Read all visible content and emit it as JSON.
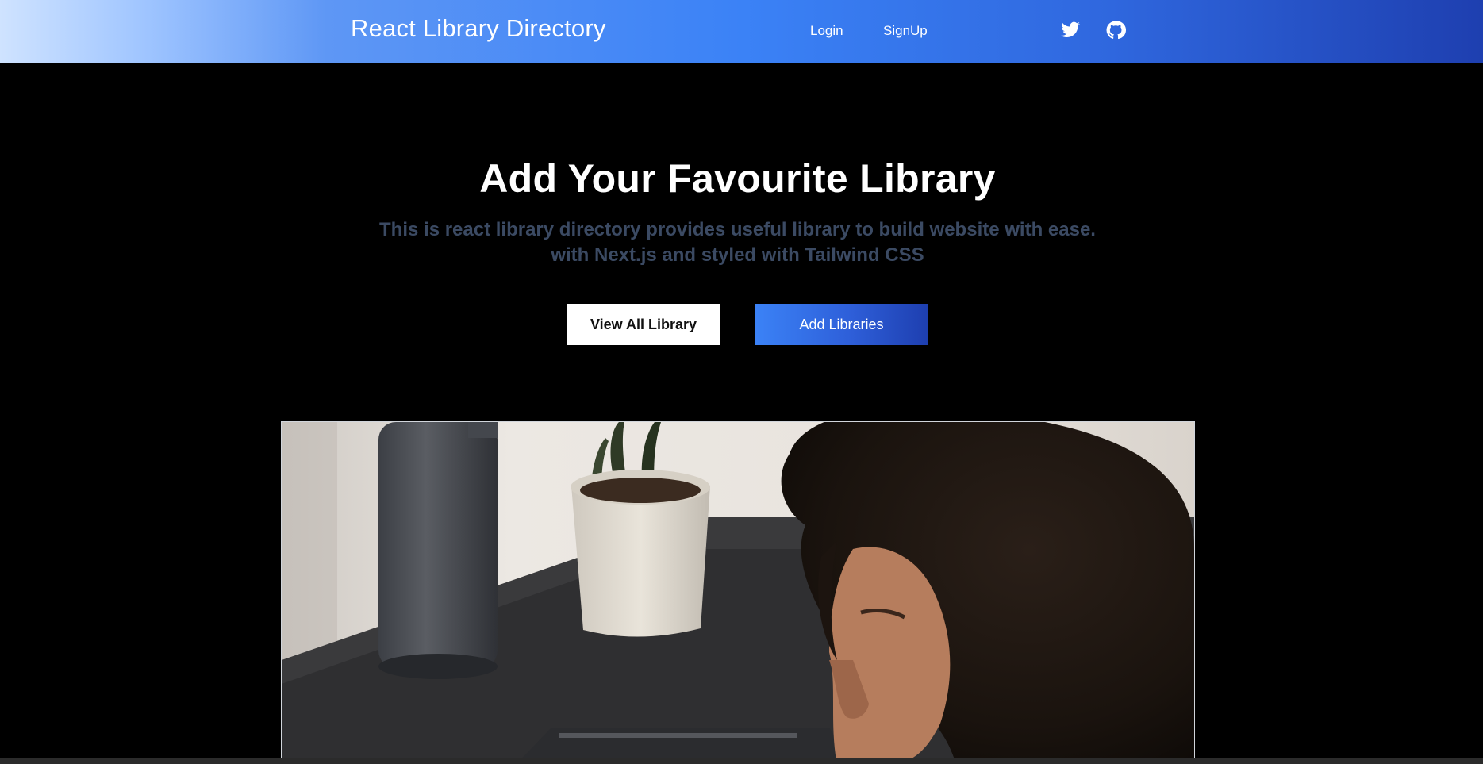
{
  "header": {
    "brand": "React Library Directory",
    "nav": {
      "login": "Login",
      "signup": "SignUp"
    },
    "social": {
      "twitter_icon": "twitter-icon",
      "github_icon": "github-icon"
    },
    "colors": {
      "gradient_start": "#cfe3ff",
      "gradient_mid": "#3b82f6",
      "gradient_end": "#1e3fb0"
    }
  },
  "hero": {
    "title": "Add Your Favourite Library",
    "subtitle_line1": "This is react library directory provides useful library to build website with ease.",
    "subtitle_line2": "with Next.js and styled with Tailwind CSS",
    "buttons": {
      "view_all": "View All Library",
      "add": "Add Libraries"
    }
  },
  "photo": {
    "alt": "Person with curly hair working at a desk with a potted plant and a thermos"
  }
}
